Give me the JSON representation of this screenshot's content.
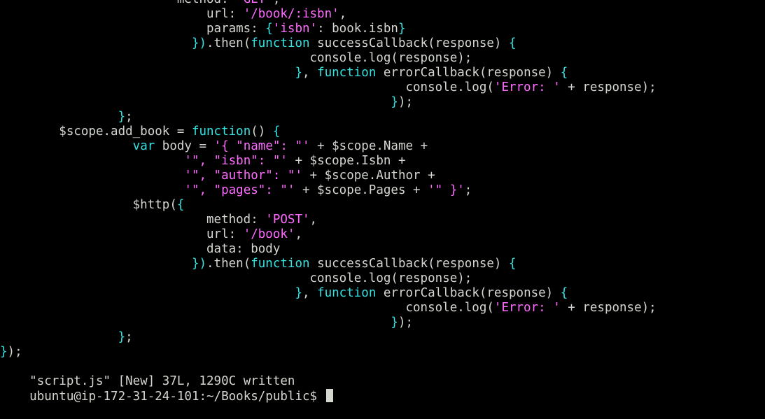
{
  "terminal": {
    "colors": {
      "background": "#000000",
      "text": "#d3d7cf",
      "keyword": "#34e2e2",
      "string": "#ff6bff",
      "cursor": "#d3d7cf"
    },
    "lines": [
      {
        "indent": 0,
        "segments": [
          {
            "text": "                        ",
            "color": "text"
          },
          {
            "text": "method: ",
            "color": "text"
          },
          {
            "text": "'GET'",
            "color": "string"
          },
          {
            "text": ",",
            "color": "text"
          }
        ]
      },
      {
        "indent": 0,
        "segments": [
          {
            "text": "                            url: ",
            "color": "text"
          },
          {
            "text": "'/book/:isbn'",
            "color": "string"
          },
          {
            "text": ",",
            "color": "text"
          }
        ]
      },
      {
        "indent": 0,
        "segments": [
          {
            "text": "                            params: ",
            "color": "text"
          },
          {
            "text": "{",
            "color": "keyword"
          },
          {
            "text": "'isbn'",
            "color": "string"
          },
          {
            "text": ": book.isbn",
            "color": "text"
          },
          {
            "text": "}",
            "color": "keyword"
          }
        ]
      },
      {
        "indent": 0,
        "segments": [
          {
            "text": "                          ",
            "color": "text"
          },
          {
            "text": "})",
            "color": "keyword"
          },
          {
            "text": ".then(",
            "color": "text"
          },
          {
            "text": "function",
            "color": "keyword"
          },
          {
            "text": " successCallback(response) ",
            "color": "text"
          },
          {
            "text": "{",
            "color": "keyword"
          }
        ]
      },
      {
        "indent": 0,
        "segments": [
          {
            "text": "                                          console.log(response);",
            "color": "text"
          }
        ]
      },
      {
        "indent": 0,
        "segments": [
          {
            "text": "                                        ",
            "color": "text"
          },
          {
            "text": "}",
            "color": "keyword"
          },
          {
            "text": ", ",
            "color": "text"
          },
          {
            "text": "function",
            "color": "keyword"
          },
          {
            "text": " errorCallback(response) ",
            "color": "text"
          },
          {
            "text": "{",
            "color": "keyword"
          }
        ]
      },
      {
        "indent": 0,
        "segments": [
          {
            "text": "                                                       console.log(",
            "color": "text"
          },
          {
            "text": "'Error: '",
            "color": "string"
          },
          {
            "text": " + response);",
            "color": "text"
          }
        ]
      },
      {
        "indent": 0,
        "segments": [
          {
            "text": "                                                     ",
            "color": "text"
          },
          {
            "text": "}",
            "color": "keyword"
          },
          {
            "text": ");",
            "color": "text"
          }
        ]
      },
      {
        "indent": 0,
        "segments": [
          {
            "text": "                ",
            "color": "text"
          },
          {
            "text": "}",
            "color": "keyword"
          },
          {
            "text": ";",
            "color": "text"
          }
        ]
      },
      {
        "indent": 0,
        "segments": [
          {
            "text": "        $scope.add_book = ",
            "color": "text"
          },
          {
            "text": "function",
            "color": "keyword"
          },
          {
            "text": "() ",
            "color": "text"
          },
          {
            "text": "{",
            "color": "keyword"
          }
        ]
      },
      {
        "indent": 0,
        "segments": [
          {
            "text": "                  ",
            "color": "text"
          },
          {
            "text": "var",
            "color": "keyword"
          },
          {
            "text": " body = ",
            "color": "text"
          },
          {
            "text": "'{ \"name\": \"'",
            "color": "string"
          },
          {
            "text": " + $scope.Name +",
            "color": "text"
          }
        ]
      },
      {
        "indent": 0,
        "segments": [
          {
            "text": "                         ",
            "color": "text"
          },
          {
            "text": "'\", \"isbn\": \"'",
            "color": "string"
          },
          {
            "text": " + $scope.Isbn +",
            "color": "text"
          }
        ]
      },
      {
        "indent": 0,
        "segments": [
          {
            "text": "                         ",
            "color": "text"
          },
          {
            "text": "'\", \"author\": \"'",
            "color": "string"
          },
          {
            "text": " + $scope.Author +",
            "color": "text"
          }
        ]
      },
      {
        "indent": 0,
        "segments": [
          {
            "text": "                         ",
            "color": "text"
          },
          {
            "text": "'\", \"pages\": \"'",
            "color": "string"
          },
          {
            "text": " + $scope.Pages + ",
            "color": "text"
          },
          {
            "text": "'\" }'",
            "color": "string"
          },
          {
            "text": ";",
            "color": "text"
          }
        ]
      },
      {
        "indent": 0,
        "segments": [
          {
            "text": "                  $http(",
            "color": "text"
          },
          {
            "text": "{",
            "color": "keyword"
          }
        ]
      },
      {
        "indent": 0,
        "segments": [
          {
            "text": "                            method: ",
            "color": "text"
          },
          {
            "text": "'POST'",
            "color": "string"
          },
          {
            "text": ",",
            "color": "text"
          }
        ]
      },
      {
        "indent": 0,
        "segments": [
          {
            "text": "                            url: ",
            "color": "text"
          },
          {
            "text": "'/book'",
            "color": "string"
          },
          {
            "text": ",",
            "color": "text"
          }
        ]
      },
      {
        "indent": 0,
        "segments": [
          {
            "text": "                            data: body",
            "color": "text"
          }
        ]
      },
      {
        "indent": 0,
        "segments": [
          {
            "text": "                          ",
            "color": "text"
          },
          {
            "text": "})",
            "color": "keyword"
          },
          {
            "text": ".then(",
            "color": "text"
          },
          {
            "text": "function",
            "color": "keyword"
          },
          {
            "text": " successCallback(response) ",
            "color": "text"
          },
          {
            "text": "{",
            "color": "keyword"
          }
        ]
      },
      {
        "indent": 0,
        "segments": [
          {
            "text": "                                          console.log(response);",
            "color": "text"
          }
        ]
      },
      {
        "indent": 0,
        "segments": [
          {
            "text": "                                        ",
            "color": "text"
          },
          {
            "text": "}",
            "color": "keyword"
          },
          {
            "text": ", ",
            "color": "text"
          },
          {
            "text": "function",
            "color": "keyword"
          },
          {
            "text": " errorCallback(response) ",
            "color": "text"
          },
          {
            "text": "{",
            "color": "keyword"
          }
        ]
      },
      {
        "indent": 0,
        "segments": [
          {
            "text": "                                                       console.log(",
            "color": "text"
          },
          {
            "text": "'Error: '",
            "color": "string"
          },
          {
            "text": " + response);",
            "color": "text"
          }
        ]
      },
      {
        "indent": 0,
        "segments": [
          {
            "text": "                                                     ",
            "color": "text"
          },
          {
            "text": "}",
            "color": "keyword"
          },
          {
            "text": ");",
            "color": "text"
          }
        ]
      },
      {
        "indent": 0,
        "segments": [
          {
            "text": "                ",
            "color": "text"
          },
          {
            "text": "}",
            "color": "keyword"
          },
          {
            "text": ";",
            "color": "text"
          }
        ]
      },
      {
        "indent": 0,
        "segments": [
          {
            "text": "}",
            "color": "keyword"
          },
          {
            "text": ");",
            "color": "text"
          }
        ]
      }
    ],
    "status_message": "\"script.js\" [New] 37L, 1290C written",
    "prompt": "ubuntu@ip-172-31-24-101:~/Books/public$ "
  }
}
